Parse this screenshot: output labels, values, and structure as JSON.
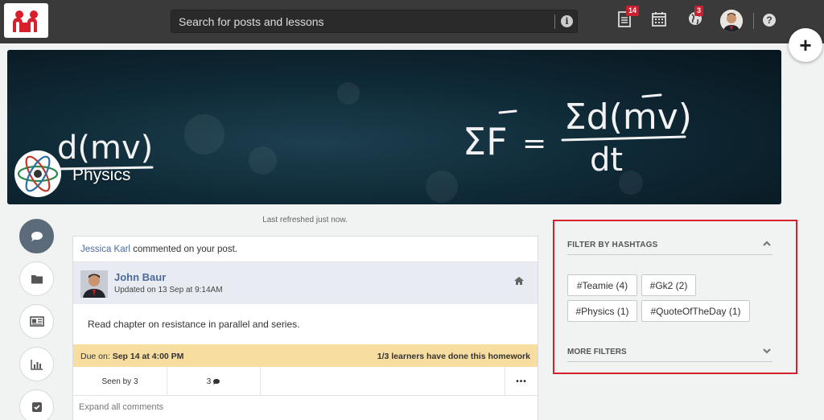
{
  "header": {
    "search_placeholder": "Search for posts and lessons",
    "notifications_count": "14",
    "messages_count": "3",
    "help_label": "?",
    "create_label": "+"
  },
  "banner": {
    "course_title": "Physics",
    "formula_main": "ΣF = Σd(mv) / dt",
    "more_label": "•••"
  },
  "rail": {
    "items": [
      {
        "icon": "chat-bubble-icon",
        "active": true
      },
      {
        "icon": "folder-icon"
      },
      {
        "icon": "id-card-icon"
      },
      {
        "icon": "bar-chart-icon"
      },
      {
        "icon": "checkbox-icon"
      }
    ]
  },
  "feed": {
    "refreshed": "Last refreshed just now.",
    "post": {
      "notif_name": "Jessica Karl",
      "notif_text": " commented on your post.",
      "author": "John Baur",
      "updated": "Updated on 13 Sep at 9:14AM",
      "body": "Read chapter on resistance in parallel and series.",
      "due_prefix": "Due on: ",
      "due_date": "Sep 14 at 4:00 PM",
      "progress": "1/3 learners have done this homework",
      "seen_by": "Seen by 3",
      "comments_count": "3",
      "more": "•••",
      "expand_comments": "Expand all comments"
    }
  },
  "filters": {
    "title": "FILTER BY HASHTAGS",
    "tags": [
      "#Teamie (4)",
      "#Gk2 (2)",
      "#Physics (1)",
      "#QuoteOfTheDay (1)"
    ],
    "more_filters": "MORE FILTERS"
  },
  "colors": {
    "topbar": "#3a3a3a",
    "accent_link": "#4d6b9a",
    "badge": "#c8202f",
    "due_bar": "#f7dea0",
    "highlight_border": "#d8202c"
  }
}
